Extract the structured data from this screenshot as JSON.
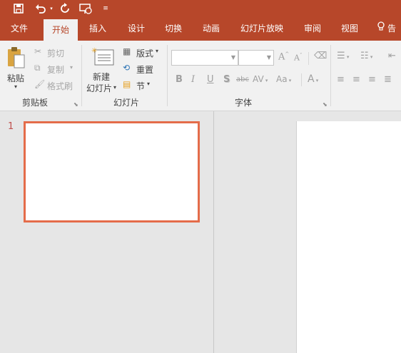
{
  "quick_access": {
    "save_icon": "save-icon",
    "undo_icon": "undo-icon",
    "redo_icon": "redo-icon",
    "present_icon": "start-from-beginning-icon",
    "customize_icon": "customize-qat-icon"
  },
  "tabs": [
    {
      "label": "文件"
    },
    {
      "label": "开始"
    },
    {
      "label": "插入"
    },
    {
      "label": "设计"
    },
    {
      "label": "切换"
    },
    {
      "label": "动画"
    },
    {
      "label": "幻灯片放映"
    },
    {
      "label": "审阅"
    },
    {
      "label": "视图"
    },
    {
      "label": "告"
    }
  ],
  "ribbon": {
    "clipboard": {
      "paste_label": "粘贴",
      "cut_label": "剪切",
      "copy_label": "复制",
      "format_painter_label": "格式刷",
      "group_label": "剪贴板"
    },
    "slides": {
      "new_slide_line1": "新建",
      "new_slide_line2": "幻灯片",
      "layout_label": "版式",
      "reset_label": "重置",
      "section_label": "节",
      "group_label": "幻灯片"
    },
    "font": {
      "font_name_value": "",
      "font_size_value": "",
      "bold": "B",
      "italic": "I",
      "underline": "U",
      "shadow": "S",
      "strikethrough": "abc",
      "char_spacing": "AV",
      "change_case": "Aa",
      "font_color": "A",
      "group_label": "字体"
    }
  },
  "thumbnails": {
    "slide_number": "1"
  },
  "colors": {
    "accent": "#b7472a",
    "thumb_border": "#e46c4a"
  }
}
